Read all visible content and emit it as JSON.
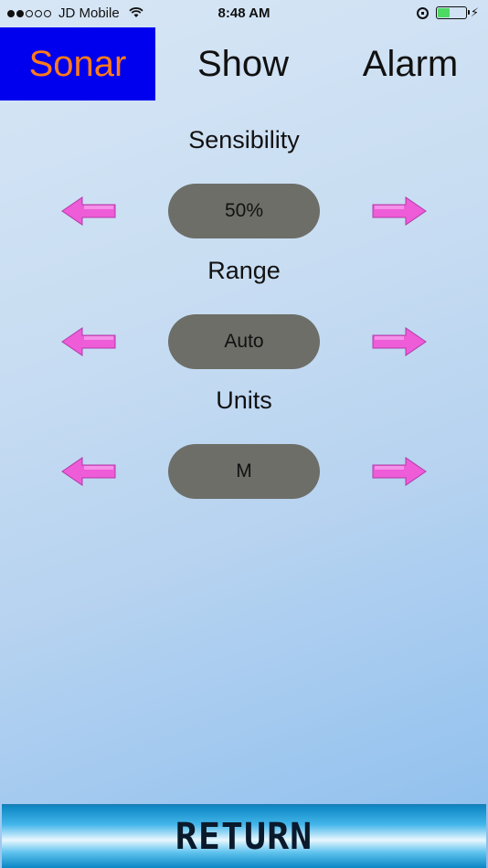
{
  "status_bar": {
    "carrier": "JD Mobile",
    "time": "8:48 AM",
    "signal_filled": 2,
    "signal_total": 5
  },
  "tabs": [
    {
      "id": "sonar",
      "label": "Sonar",
      "active": true
    },
    {
      "id": "show",
      "label": "Show",
      "active": false
    },
    {
      "id": "alarm",
      "label": "Alarm",
      "active": false
    }
  ],
  "settings": [
    {
      "id": "sensibility",
      "label": "Sensibility",
      "value": "50%"
    },
    {
      "id": "range",
      "label": "Range",
      "value": "Auto"
    },
    {
      "id": "units",
      "label": "Units",
      "value": "M"
    }
  ],
  "footer": {
    "return_label": "RETURN"
  },
  "colors": {
    "active_tab_bg": "#0000ee",
    "active_tab_text": "#ff7a1a",
    "arrow_fill": "#ee5cd8",
    "pill_bg": "#6d6e68",
    "return_bg": "#43b6ea"
  }
}
